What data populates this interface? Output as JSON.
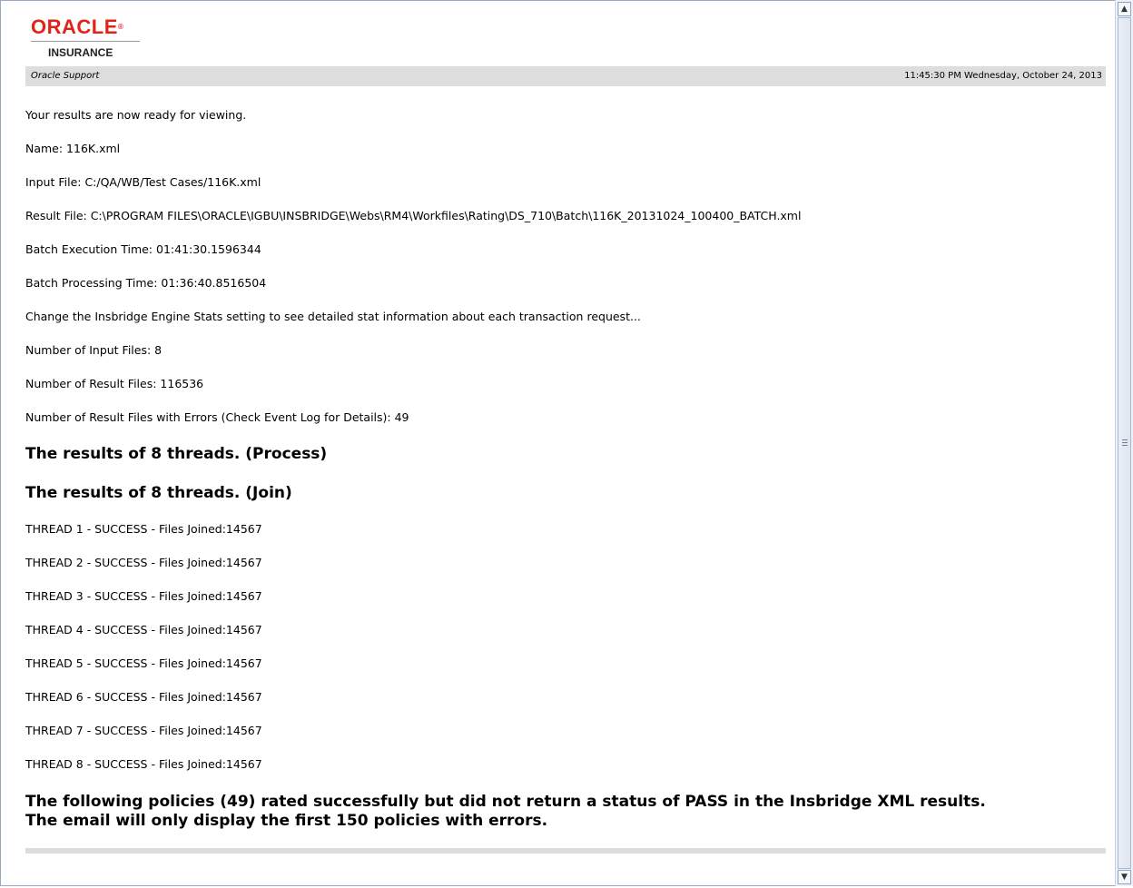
{
  "header": {
    "logo_word": "ORACLE",
    "logo_trademark": "®",
    "logo_subtitle": "INSURANCE",
    "support_label": "Oracle Support",
    "timestamp": "11:45:30 PM Wednesday, October 24, 2013"
  },
  "body": {
    "intro": "Your results are now ready for viewing.",
    "name": "Name: 116K.xml",
    "input_file": "Input File: C:/QA/WB/Test Cases/116K.xml",
    "result_file": "Result File: C:\\PROGRAM FILES\\ORACLE\\IGBU\\INSBRIDGE\\Webs\\RM4\\Workfiles\\Rating\\DS_710\\Batch\\116K_20131024_100400_BATCH.xml",
    "batch_execution_time": "Batch Execution Time: 01:41:30.1596344",
    "batch_processing_time": "Batch Processing Time: 01:36:40.8516504",
    "stats_note": "Change the Insbridge Engine Stats setting to see detailed stat information about each transaction request...",
    "num_input_files": "Number of Input Files: 8",
    "num_result_files": "Number of Result Files: 116536",
    "num_result_errors": "Number of Result Files with Errors (Check Event Log for Details): 49",
    "heading_process": "The results of 8 threads. (Process)",
    "heading_join": "The results of 8 threads. (Join)",
    "threads": [
      "THREAD 1 - SUCCESS - Files Joined:14567",
      "THREAD 2 - SUCCESS - Files Joined:14567",
      "THREAD 3 - SUCCESS - Files Joined:14567",
      "THREAD 4 - SUCCESS - Files Joined:14567",
      "THREAD 5 - SUCCESS - Files Joined:14567",
      "THREAD 6 - SUCCESS - Files Joined:14567",
      "THREAD 7 - SUCCESS - Files Joined:14567",
      "THREAD 8 - SUCCESS - Files Joined:14567"
    ],
    "policies_heading_line1": "The following policies (49) rated successfully but did not return a status of PASS in the Insbridge XML results.",
    "policies_heading_line2": "The email will only display the first 150 policies with errors."
  },
  "scrollbar": {
    "up_icon": "arrow-up-icon",
    "down_icon": "arrow-down-icon"
  },
  "colors": {
    "brand_red": "#e2231a",
    "bar_gray": "#dddddd"
  }
}
